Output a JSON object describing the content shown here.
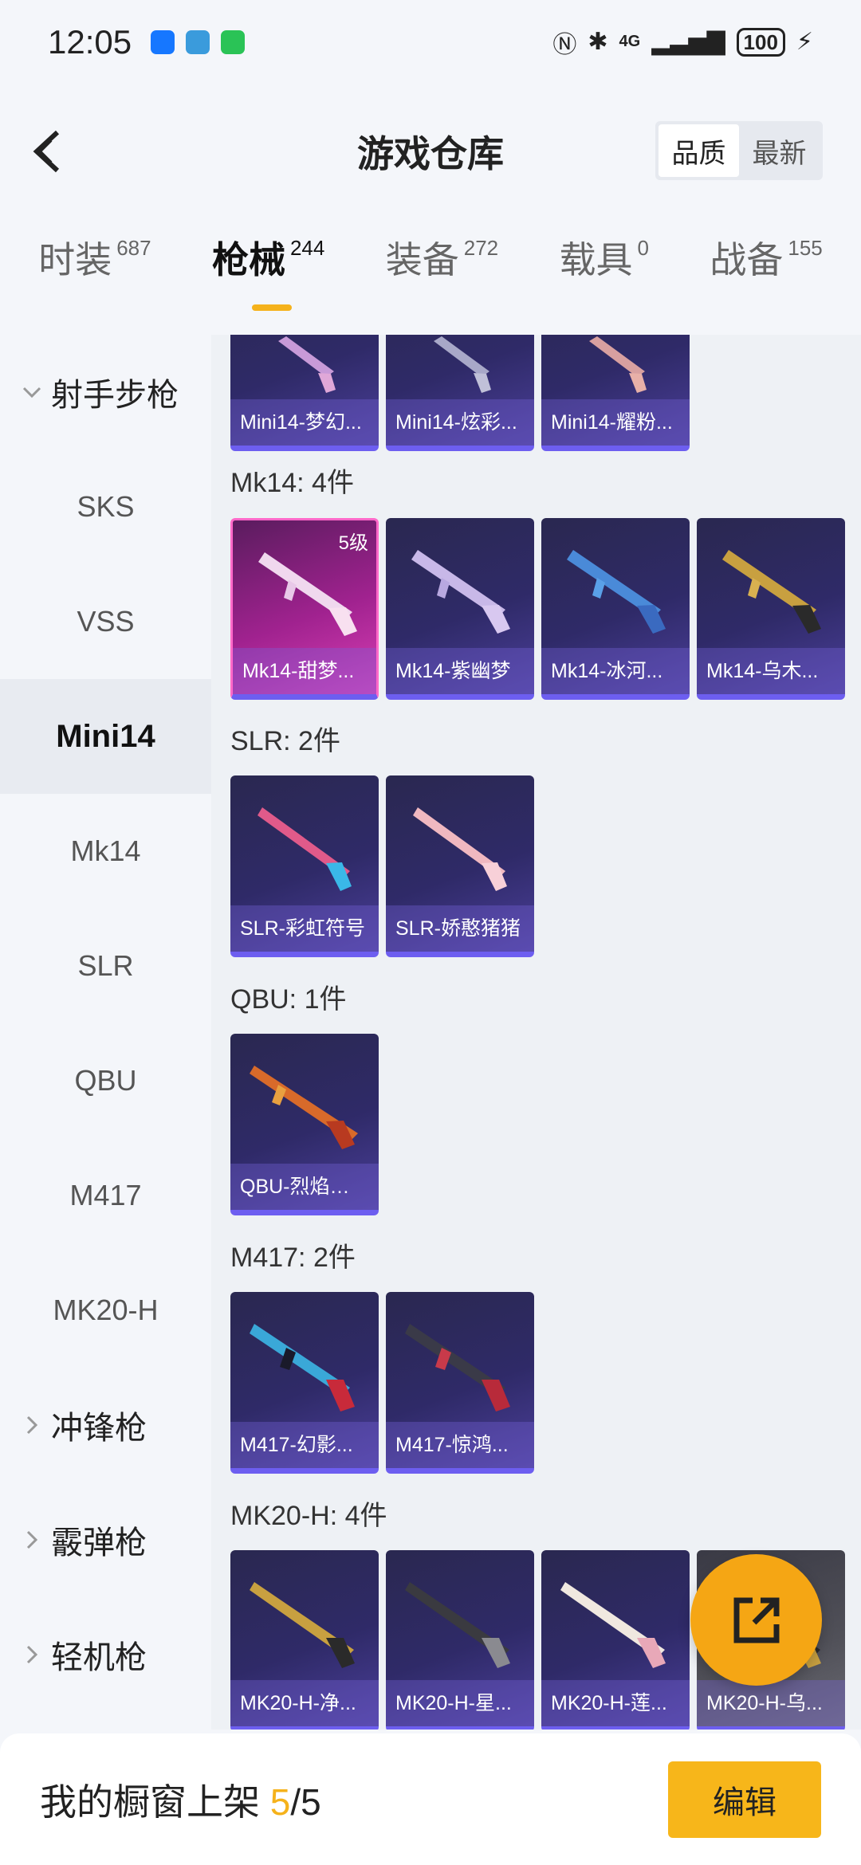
{
  "status_bar": {
    "time": "12:05",
    "battery": "100",
    "network": "4G"
  },
  "header": {
    "title": "游戏仓库",
    "sort_options": [
      "品质",
      "最新"
    ],
    "active_sort": "品质"
  },
  "tabs": [
    {
      "label": "时装",
      "count": "687"
    },
    {
      "label": "枪械",
      "count": "244",
      "active": true
    },
    {
      "label": "装备",
      "count": "272"
    },
    {
      "label": "载具",
      "count": "0"
    },
    {
      "label": "战备",
      "count": "155"
    }
  ],
  "sidebar": {
    "group_open": "射手步枪",
    "items": [
      "SKS",
      "VSS",
      "Mini14",
      "Mk14",
      "SLR",
      "QBU",
      "M417",
      "MK20-H"
    ],
    "active_item": "Mini14",
    "groups_collapsed": [
      "冲锋枪",
      "霰弹枪",
      "轻机枪"
    ]
  },
  "sections": [
    {
      "title": "",
      "items": [
        "Mini14-梦幻...",
        "Mini14-炫彩...",
        "Mini14-耀粉..."
      ]
    },
    {
      "title": "Mk14: 4件",
      "items": [
        "Mk14-甜梦...",
        "Mk14-紫幽梦",
        "Mk14-冰河...",
        "Mk14-乌木..."
      ],
      "first_level": "5级"
    },
    {
      "title": "SLR: 2件",
      "items": [
        "SLR-彩虹符号",
        "SLR-娇憨猪猪"
      ]
    },
    {
      "title": "QBU: 1件",
      "items": [
        "QBU-烈焰拳霸"
      ]
    },
    {
      "title": "M417: 2件",
      "items": [
        "M417-幻影...",
        "M417-惊鸿..."
      ]
    },
    {
      "title": "MK20-H: 4件",
      "items": [
        "MK20-H-净...",
        "MK20-H-星...",
        "MK20-H-莲...",
        "MK20-H-乌..."
      ]
    }
  ],
  "bottom_bar": {
    "label": "我的橱窗上架",
    "current": "5",
    "total": "/5",
    "edit_label": "编辑"
  },
  "colors": {
    "accent": "#f5b21b",
    "card_bg": "#2f2a68",
    "card_border": "#6d5ef0"
  }
}
